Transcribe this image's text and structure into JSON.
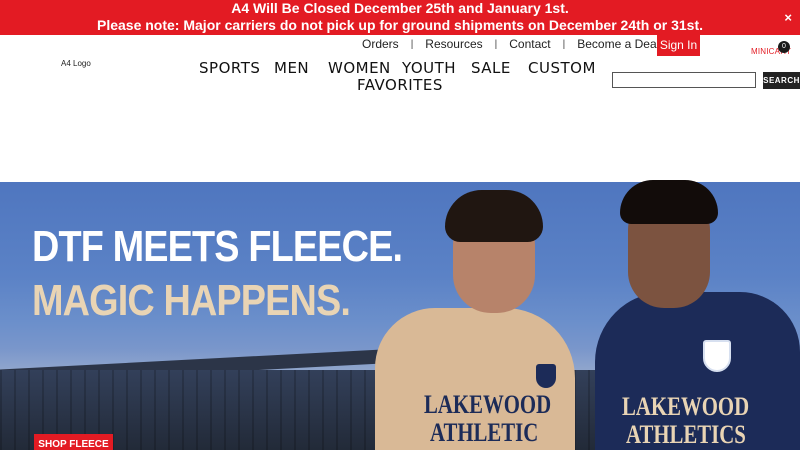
{
  "announcement": {
    "line1": "A4 Will Be Closed December 25th and January 1st.",
    "line2": "Please note: Major carriers do not pick up for ground shipments on December 24th or 31st.",
    "close": "×"
  },
  "utility_nav": [
    "Orders",
    "Resources",
    "Contact",
    "Become a Dealer"
  ],
  "utility_sep": "|",
  "sign_in": "Sign In",
  "minicart": {
    "label": "MINICART",
    "count": "0"
  },
  "logo_alt": "A4 Logo",
  "main_nav": {
    "sports": "SPORTS",
    "men": "MEN",
    "women": "WOMEN",
    "youth": "YOUTH",
    "sale": "SALE",
    "custom": "CUSTOM",
    "favorites": "FAVORITES"
  },
  "search": {
    "placeholder": "",
    "button": "SEARCH"
  },
  "hero": {
    "headline1": "DTF MEETS FLEECE.",
    "headline2": "MAGIC HAPPENS.",
    "cta": "SHOP FLEECE",
    "shirt_text_1": "LAKEWOOD",
    "shirt_text_2": "ATHLETIC",
    "shirt_text_3": "LAKEWOOD",
    "shirt_text_4": "ATHLETICS"
  },
  "colors": {
    "brand_red": "#e31b23",
    "hero_sky": "#5b82c6",
    "navy": "#1c2b58",
    "tan": "#e9d4b4"
  }
}
